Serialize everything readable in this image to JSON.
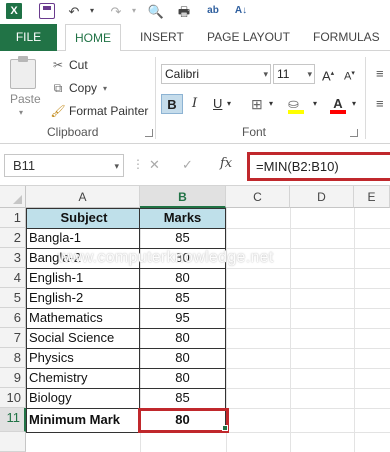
{
  "quick_access": {
    "icons": [
      "excel-logo-icon",
      "save-icon",
      "undo-icon",
      "redo-icon",
      "print-preview-icon",
      "quick-print-icon",
      "spelling-icon",
      "sort-icon"
    ]
  },
  "tabs": [
    "FILE",
    "HOME",
    "INSERT",
    "PAGE LAYOUT",
    "FORMULAS"
  ],
  "clipboard": {
    "paste_label": "Paste",
    "cut_label": "Cut",
    "copy_label": "Copy",
    "format_painter_label": "Format Painter",
    "group_label": "Clipboard"
  },
  "font": {
    "font_name": "Calibri",
    "font_size": "11",
    "group_label": "Font",
    "bold_label": "B",
    "italic_label": "I",
    "underline_label": "U",
    "fill_color": "#ffff00",
    "font_color": "#ff0000"
  },
  "formula_bar": {
    "name_box": "B11",
    "fx_label": "fx",
    "formula": "=MIN(B2:B10)"
  },
  "grid": {
    "columns": [
      "A",
      "B",
      "C",
      "D",
      "E"
    ],
    "selected_column": "B",
    "rows": [
      "1",
      "2",
      "3",
      "4",
      "5",
      "6",
      "7",
      "8",
      "9",
      "10",
      "11"
    ],
    "selected_row": "11",
    "header": {
      "subject": "Subject",
      "marks": "Marks"
    },
    "data": [
      {
        "subject": "Bangla-1",
        "marks": "85"
      },
      {
        "subject": "Bangla-2",
        "marks": "80"
      },
      {
        "subject": "English-1",
        "marks": "80"
      },
      {
        "subject": "English-2",
        "marks": "85"
      },
      {
        "subject": "Mathematics",
        "marks": "95"
      },
      {
        "subject": "Social Science",
        "marks": "80"
      },
      {
        "subject": "Physics",
        "marks": "80"
      },
      {
        "subject": "Chemistry",
        "marks": "80"
      },
      {
        "subject": "Biology",
        "marks": "85"
      }
    ],
    "result": {
      "label": "Minimum Mark",
      "value": "80"
    },
    "header_fill": "#bfe0ea",
    "highlight_color": "#c0282c"
  },
  "watermark": "www.computerknowledge.net"
}
